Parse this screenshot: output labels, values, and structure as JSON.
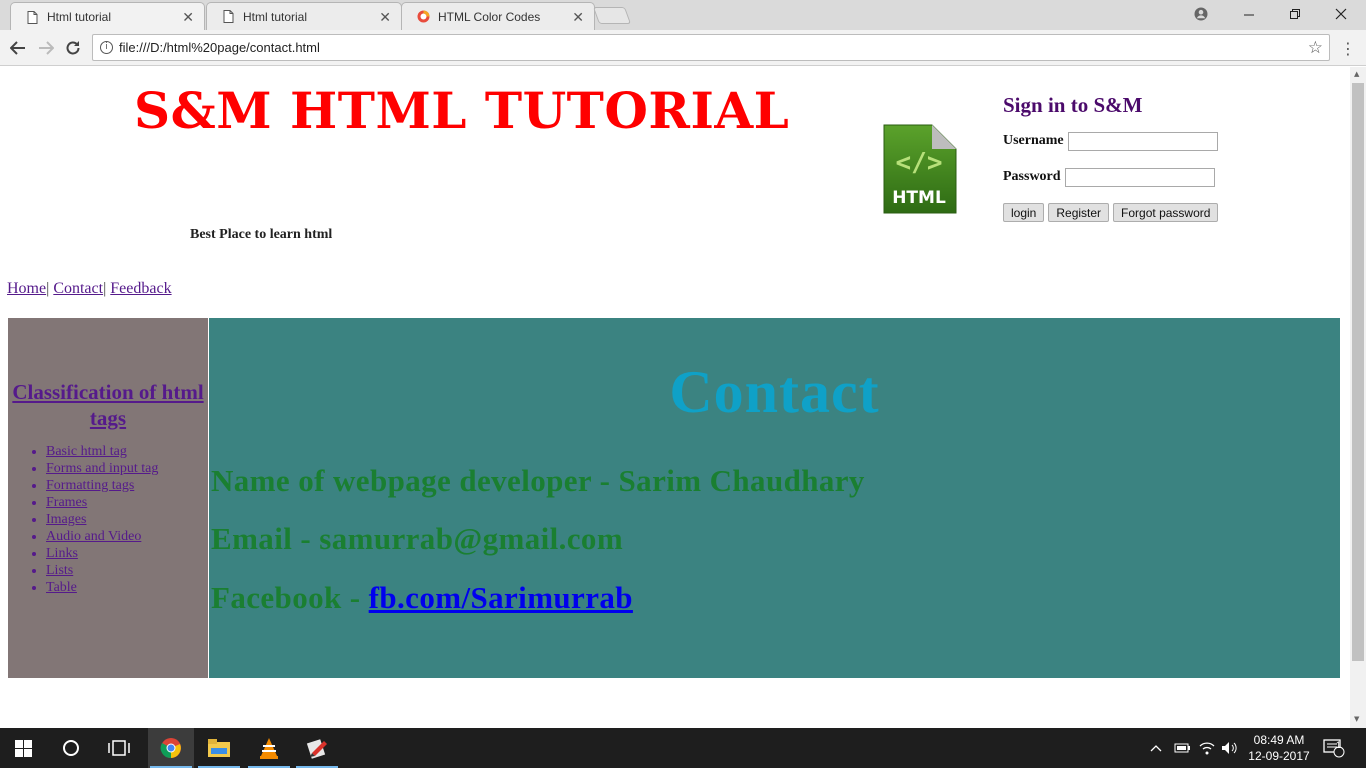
{
  "browser": {
    "tabs": [
      {
        "title": "Html tutorial",
        "active": true,
        "icon": "page-icon"
      },
      {
        "title": "Html tutorial",
        "active": false,
        "icon": "page-icon"
      },
      {
        "title": "HTML Color Codes",
        "active": false,
        "icon": "colorwheel-icon"
      }
    ],
    "url": "file:///D:/html%20page/contact.html"
  },
  "header": {
    "site_title": "S&M HTML TUTORIAL",
    "tagline": "Best Place to learn html",
    "logo_text": "HTML",
    "logo_code": "</>"
  },
  "signin": {
    "heading": "Sign in to S&M",
    "username_label": "Username",
    "password_label": "Password",
    "username_value": "",
    "password_value": "",
    "login_label": "login",
    "register_label": "Register",
    "forgot_label": "Forgot password"
  },
  "nav": {
    "home": "Home",
    "contact": "Contact",
    "feedback": "Feedback",
    "separator": "|"
  },
  "sidebar": {
    "heading": "Classification of html tags",
    "items": [
      "Basic html tag",
      "Forms and input tag",
      "Formatting tags",
      "Frames",
      "Images",
      "Audio and Video",
      "Links",
      "Lists",
      "Table"
    ]
  },
  "content": {
    "heading": "Contact",
    "developer": "Name of webpage developer - Sarim Chaudhary",
    "email": "Email - samurrab@gmail.com",
    "facebook_prefix": "Facebook - ",
    "facebook_link": "fb.com/Sarimurrab"
  },
  "taskbar": {
    "time": "08:49 AM",
    "date": "12-09-2017",
    "notification_count": "1"
  },
  "colors": {
    "title_red": "#ff0000",
    "sidebar_bg": "#827676",
    "content_bg": "#3b8381",
    "contact_heading": "#0fa1c7",
    "info_green": "#1a7f31",
    "link_visited": "#551a8b"
  }
}
